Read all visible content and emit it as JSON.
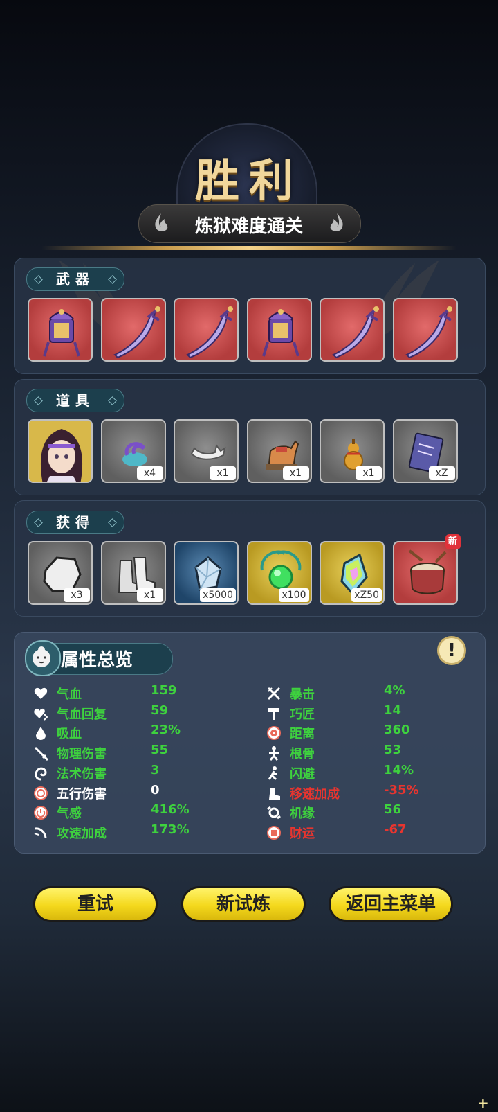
{
  "header": {
    "title": "胜利",
    "subtitle": "炼狱难度通关"
  },
  "sections": {
    "weapons": {
      "label": "武器",
      "items": [
        {
          "icon": "lantern-icon",
          "frame": "red"
        },
        {
          "icon": "curved-blade-icon",
          "frame": "red"
        },
        {
          "icon": "curved-blade-icon",
          "frame": "red"
        },
        {
          "icon": "lantern-icon",
          "frame": "red"
        },
        {
          "icon": "curved-blade-icon",
          "frame": "red"
        },
        {
          "icon": "curved-blade-icon",
          "frame": "red"
        }
      ]
    },
    "props": {
      "label": "道具",
      "items": [
        {
          "icon": "character-portrait-icon",
          "frame": "gold",
          "qty": ""
        },
        {
          "icon": "swirl-orb-icon",
          "frame": "gray",
          "qty": "x4"
        },
        {
          "icon": "white-bone-icon",
          "frame": "gray",
          "qty": "x1"
        },
        {
          "icon": "horse-figurine-icon",
          "frame": "gray",
          "qty": "x1"
        },
        {
          "icon": "gourd-icon",
          "frame": "gray",
          "qty": "x1"
        },
        {
          "icon": "book-icon",
          "frame": "gray",
          "qty": "xZ"
        }
      ]
    },
    "obtained": {
      "label": "获得",
      "items": [
        {
          "icon": "white-stone-icon",
          "frame": "gray",
          "qty": "x3"
        },
        {
          "icon": "boots-icon",
          "frame": "gray",
          "qty": "x1"
        },
        {
          "icon": "crystal-icon",
          "frame": "blue",
          "qty": "x5000"
        },
        {
          "icon": "green-orb-icon",
          "frame": "gold",
          "qty": "x100"
        },
        {
          "icon": "rainbow-gem-icon",
          "frame": "gold",
          "qty": "xZ50"
        },
        {
          "icon": "drum-icon",
          "frame": "red",
          "qty": "",
          "badge": "新"
        }
      ]
    }
  },
  "stats": {
    "title": "属性总览",
    "info_symbol": "!",
    "left": [
      {
        "label": "气血",
        "value": "159",
        "icon": "heart-icon",
        "label_color": "green",
        "value_color": "green"
      },
      {
        "label": "气血回复",
        "value": "59",
        "icon": "heart-regen-icon",
        "label_color": "green",
        "value_color": "green"
      },
      {
        "label": "吸血",
        "value": "23%",
        "icon": "blood-drop-icon",
        "label_color": "green",
        "value_color": "green"
      },
      {
        "label": "物理伤害",
        "value": "55",
        "icon": "sword-icon",
        "label_color": "green",
        "value_color": "green"
      },
      {
        "label": "法术伤害",
        "value": "3",
        "icon": "spiral-icon",
        "label_color": "green",
        "value_color": "green"
      },
      {
        "label": "五行伤害",
        "value": "0",
        "icon": "target-spiral-icon",
        "label_color": "white",
        "value_color": "white"
      },
      {
        "label": "气感",
        "value": "416%",
        "icon": "power-icon",
        "label_color": "green",
        "value_color": "green"
      },
      {
        "label": "攻速加成",
        "value": "173%",
        "icon": "attack-speed-icon",
        "label_color": "green",
        "value_color": "green"
      }
    ],
    "right": [
      {
        "label": "暴击",
        "value": "4%",
        "icon": "critical-icon",
        "label_color": "green",
        "value_color": "green"
      },
      {
        "label": "巧匠",
        "value": "14",
        "icon": "hammer-icon",
        "label_color": "green",
        "value_color": "green"
      },
      {
        "label": "距离",
        "value": "360",
        "icon": "range-icon",
        "label_color": "green",
        "value_color": "green"
      },
      {
        "label": "根骨",
        "value": "53",
        "icon": "body-icon",
        "label_color": "green",
        "value_color": "green"
      },
      {
        "label": "闪避",
        "value": "14%",
        "icon": "dodge-icon",
        "label_color": "green",
        "value_color": "green"
      },
      {
        "label": "移速加成",
        "value": "-35%",
        "icon": "boot-speed-icon",
        "label_color": "red",
        "value_color": "red"
      },
      {
        "label": "机缘",
        "value": "56",
        "icon": "luck-icon",
        "label_color": "green",
        "value_color": "green"
      },
      {
        "label": "财运",
        "value": "-67",
        "icon": "coin-icon",
        "label_color": "red",
        "value_color": "red"
      }
    ]
  },
  "buttons": {
    "retry": "重试",
    "new_trial": "新试炼",
    "main_menu": "返回主菜单"
  },
  "colors": {
    "stat_green": "#3ed23e",
    "stat_red": "#e8352f",
    "button_yellow": "#f4d81c",
    "title_gold": "#f1d79b"
  }
}
